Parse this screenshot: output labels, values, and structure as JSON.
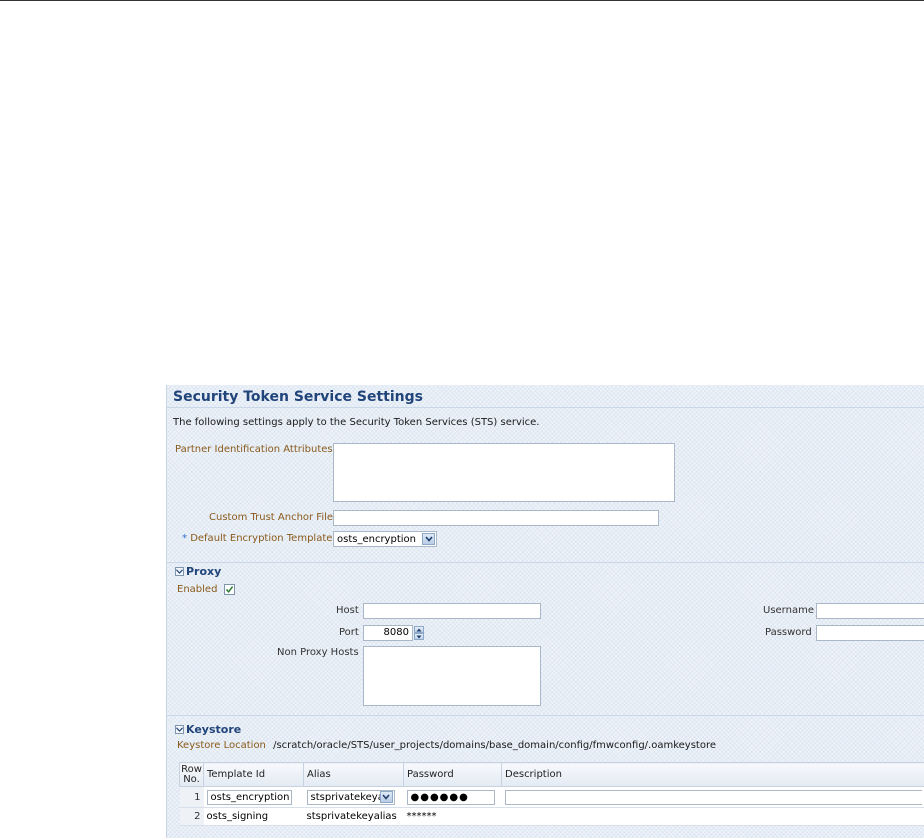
{
  "sts": {
    "title": "Security Token Service Settings",
    "intro": "The following settings apply to the Security Token Services (STS) service.",
    "partner_attrs_label": "Partner Identification Attributes",
    "partner_attrs_value": "",
    "trust_anchor_label": "Custom Trust Anchor File",
    "trust_anchor_value": "",
    "required_marker": "*",
    "encryption_template_label": "Default Encryption Template",
    "encryption_template_value": "osts_encryption"
  },
  "proxy": {
    "section_label": "Proxy",
    "enabled_label": "Enabled",
    "enabled": true,
    "host_label": "Host",
    "host_value": "",
    "port_label": "Port",
    "port_value": "8080",
    "non_proxy_label": "Non Proxy Hosts",
    "non_proxy_value": "",
    "username_label": "Username",
    "username_value": "",
    "password_label": "Password",
    "password_value": ""
  },
  "keystore": {
    "section_label": "Keystore",
    "location_label": "Keystore Location",
    "location_value": "/scratch/oracle/STS/user_projects/domains/base_domain/config/fmwconfig/.oamkeystore",
    "table": {
      "headers": {
        "row_no": "Row No.",
        "template_id": "Template Id",
        "alias": "Alias",
        "password": "Password",
        "description": "Description"
      },
      "rows": [
        {
          "row_no": "1",
          "template_id": "osts_encryption",
          "alias": "stsprivatekeya",
          "password": "●●●●●●",
          "description": ""
        },
        {
          "row_no": "2",
          "template_id": "osts_signing",
          "alias": "stsprivatekeyalias",
          "password": "******",
          "description": ""
        }
      ]
    }
  },
  "icons": {
    "dropdown": "chevron-down-icon",
    "disclosure": "disclosure-expanded-icon",
    "check": "checkmark-icon",
    "spinner": "spinner-icon"
  },
  "colors": {
    "title": "#21457a",
    "label": "#8a5a1a",
    "required": "#2f6fbf"
  }
}
